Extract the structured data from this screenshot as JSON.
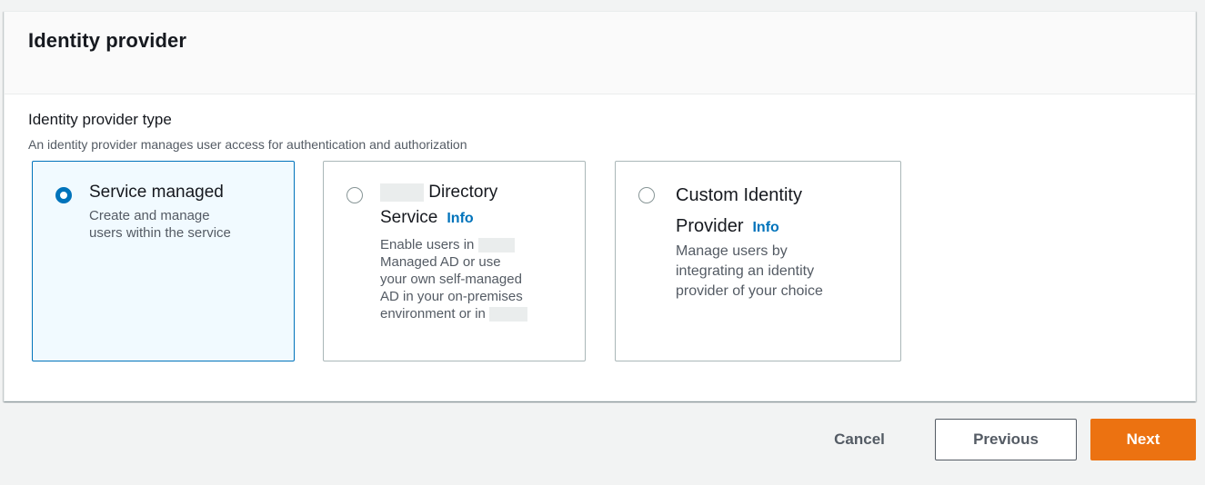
{
  "panel": {
    "title": "Identity provider",
    "field_label": "Identity provider type",
    "field_description": "An identity provider manages user access for authentication and authorization"
  },
  "tiles": [
    {
      "title": "Service managed",
      "description_lines": [
        "Create and manage",
        "users within the service"
      ],
      "selected": true
    },
    {
      "title_line1": "Directory",
      "title_line2": "Service",
      "info": "Info",
      "description_lines": [
        "Enable users in",
        "Managed AD or use",
        "your own self-managed",
        "AD in your on-premises",
        "environment or in"
      ],
      "selected": false
    },
    {
      "title_line1": "Custom Identity",
      "title_line2": "Provider",
      "info": "Info",
      "description_lines": [
        "Manage users by",
        "integrating an identity",
        "provider of your choice"
      ],
      "selected": false
    }
  ],
  "actions": {
    "cancel": "Cancel",
    "previous": "Previous",
    "next": "Next"
  },
  "colors": {
    "accent": "#0073bb",
    "primary_button": "#ec7211",
    "background": "#f2f3f3"
  }
}
